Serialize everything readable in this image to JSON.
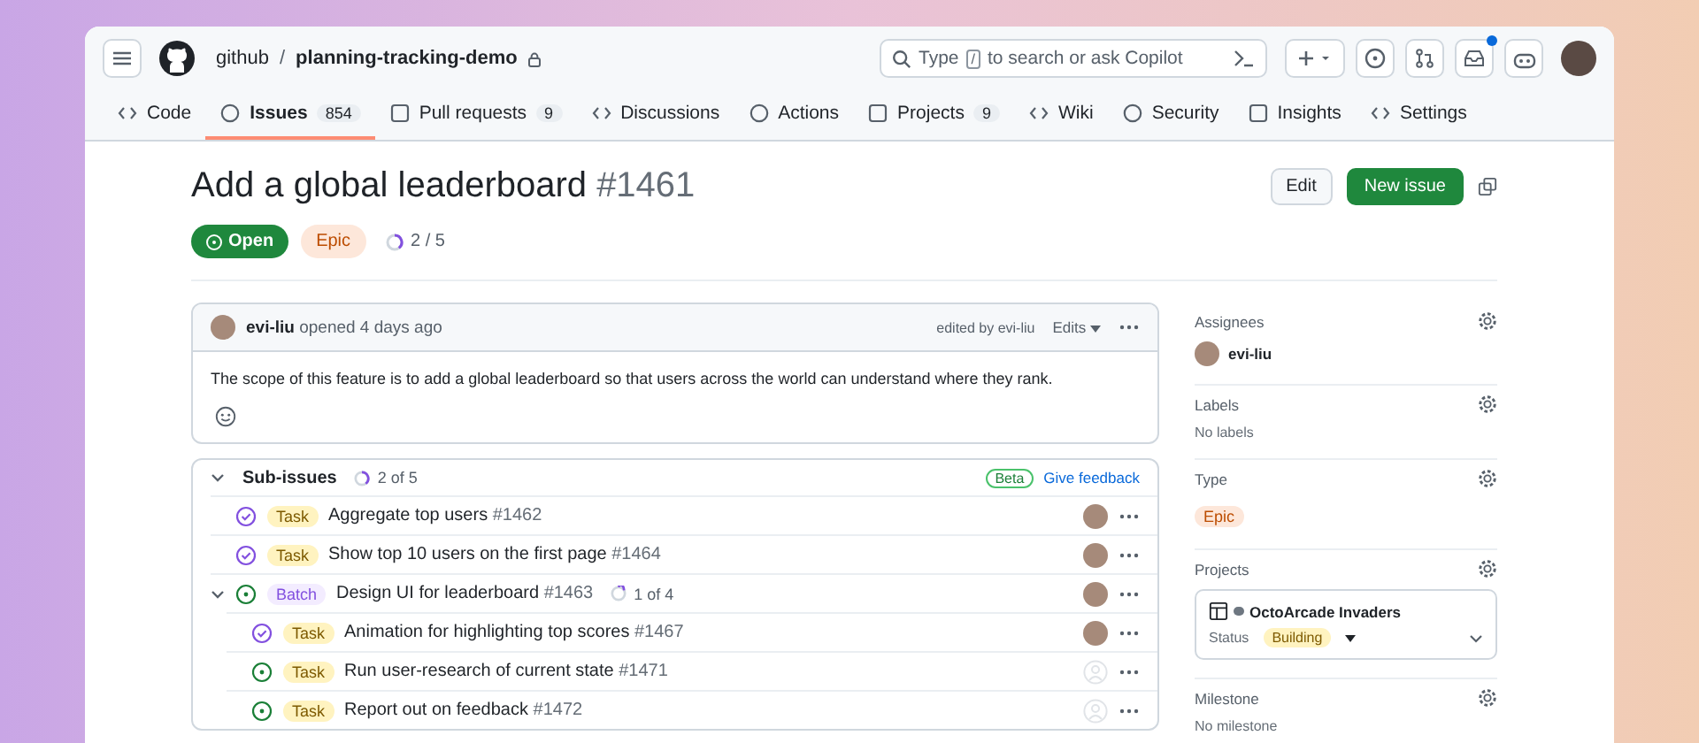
{
  "header": {
    "owner": "github",
    "separator": "/",
    "repo": "planning-tracking-demo",
    "search": {
      "before": "Type",
      "key": "/",
      "after": "to search or ask Copilot"
    },
    "notification_dot": true
  },
  "tabs": [
    {
      "label": "Code",
      "selected": false
    },
    {
      "label": "Issues",
      "count": "854",
      "selected": true
    },
    {
      "label": "Pull requests",
      "count": "9",
      "selected": false
    },
    {
      "label": "Discussions",
      "selected": false
    },
    {
      "label": "Actions",
      "selected": false
    },
    {
      "label": "Projects",
      "count": "9",
      "selected": false
    },
    {
      "label": "Wiki",
      "selected": false
    },
    {
      "label": "Security",
      "selected": false
    },
    {
      "label": "Insights",
      "selected": false
    },
    {
      "label": "Settings",
      "selected": false
    }
  ],
  "issue": {
    "title": "Add a global leaderboard",
    "number": "#1461",
    "state": "Open",
    "type": "Epic",
    "progress": "2 / 5",
    "actions": [
      "Edit",
      "New issue"
    ]
  },
  "comment": {
    "author": "evi-liu",
    "meta": "opened 4 days ago",
    "edited": "edited by evi-liu",
    "edits": "Edits",
    "body": "The scope of this feature is to add a global leaderboard so that users across the world can understand where they rank."
  },
  "sub_issues": {
    "title": "Sub-issues",
    "progress": "2 of 5",
    "expanded": true,
    "badge": "Beta",
    "feedback": "Give feedback",
    "items": [
      {
        "kind": "closed",
        "type": "Task",
        "title": "Aggregate top users",
        "number": "#1462",
        "assigned": true
      },
      {
        "kind": "closed",
        "type": "Task",
        "title": "Show top 10 users on the first page",
        "number": "#1464",
        "assigned": true
      },
      {
        "kind": "open",
        "type": "Batch",
        "title": "Design UI for leaderboard",
        "number": "#1463",
        "progress": "1 of 4",
        "assigned": true,
        "expanded": true,
        "children": [
          {
            "kind": "closed",
            "type": "Task",
            "title": "Animation for highlighting top scores",
            "number": "#1467",
            "assigned": true
          },
          {
            "kind": "open",
            "type": "Task",
            "title": "Run user-research of current state",
            "number": "#1471",
            "assigned": false
          },
          {
            "kind": "open",
            "type": "Task",
            "title": "Report out on feedback",
            "number": "#1472",
            "assigned": false
          }
        ]
      }
    ]
  },
  "sidebar": {
    "assignees": {
      "label": "Assignees",
      "name": "evi-liu"
    },
    "labels": {
      "label": "Labels",
      "empty": "No labels"
    },
    "type": {
      "label": "Type",
      "value": "Epic"
    },
    "projects": {
      "label": "Projects",
      "name": "OctoArcade Invaders",
      "status_label": "Status",
      "status": "Building"
    },
    "milestone": {
      "label": "Milestone",
      "empty": "No milestone"
    }
  }
}
